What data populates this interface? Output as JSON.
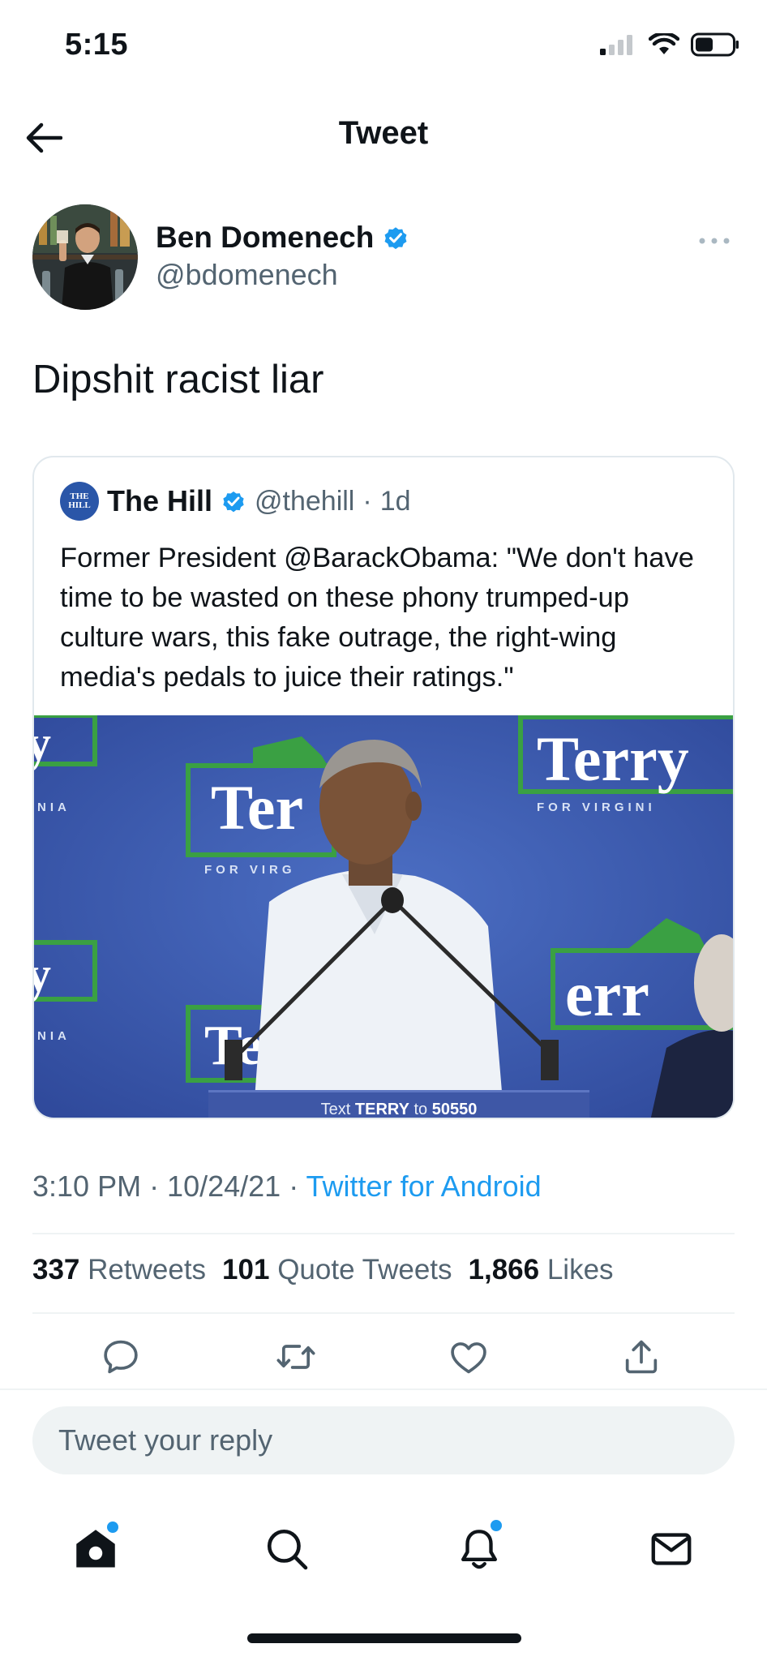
{
  "status_bar": {
    "time": "5:15"
  },
  "header": {
    "title": "Tweet"
  },
  "tweet": {
    "author_name": "Ben Domenech",
    "author_handle": "@bdomenech",
    "text": "Dipshit racist liar",
    "timestamp": "3:10 PM · 10/24/21 ·",
    "source": "Twitter for Android"
  },
  "quote": {
    "logo_text": [
      "THE",
      "HILL"
    ],
    "name": "The Hill",
    "handle": "@thehill",
    "dot": "·",
    "time": "1d",
    "text": "Former President @BarackObama: \"We don't have time to be wasted on these phony trumped-up culture wars, this fake outrage, the right-wing media's pedals to juice their ratings.\"",
    "media": {
      "sign_main": "Terry",
      "sign_sub": "FOR VIRGINIA",
      "podium_text_prefix": "Text ",
      "podium_text_keyword": "TERRY",
      "podium_text_mid": " to ",
      "podium_text_number": "50550"
    }
  },
  "stats": {
    "retweets_count": "337",
    "retweets_label": "Retweets",
    "quotes_count": "101",
    "quotes_label": "Quote Tweets",
    "likes_count": "1,866",
    "likes_label": "Likes"
  },
  "reply": {
    "placeholder": "Tweet your reply"
  },
  "colors": {
    "accent": "#1d9bf0",
    "text_primary": "#0f1419",
    "text_secondary": "#536471",
    "divider": "#eff3f4"
  },
  "icons": {
    "actions": [
      "reply-icon",
      "retweet-icon",
      "like-icon",
      "share-icon"
    ],
    "tabs": [
      "home-icon",
      "search-icon",
      "notifications-icon",
      "messages-icon"
    ]
  }
}
